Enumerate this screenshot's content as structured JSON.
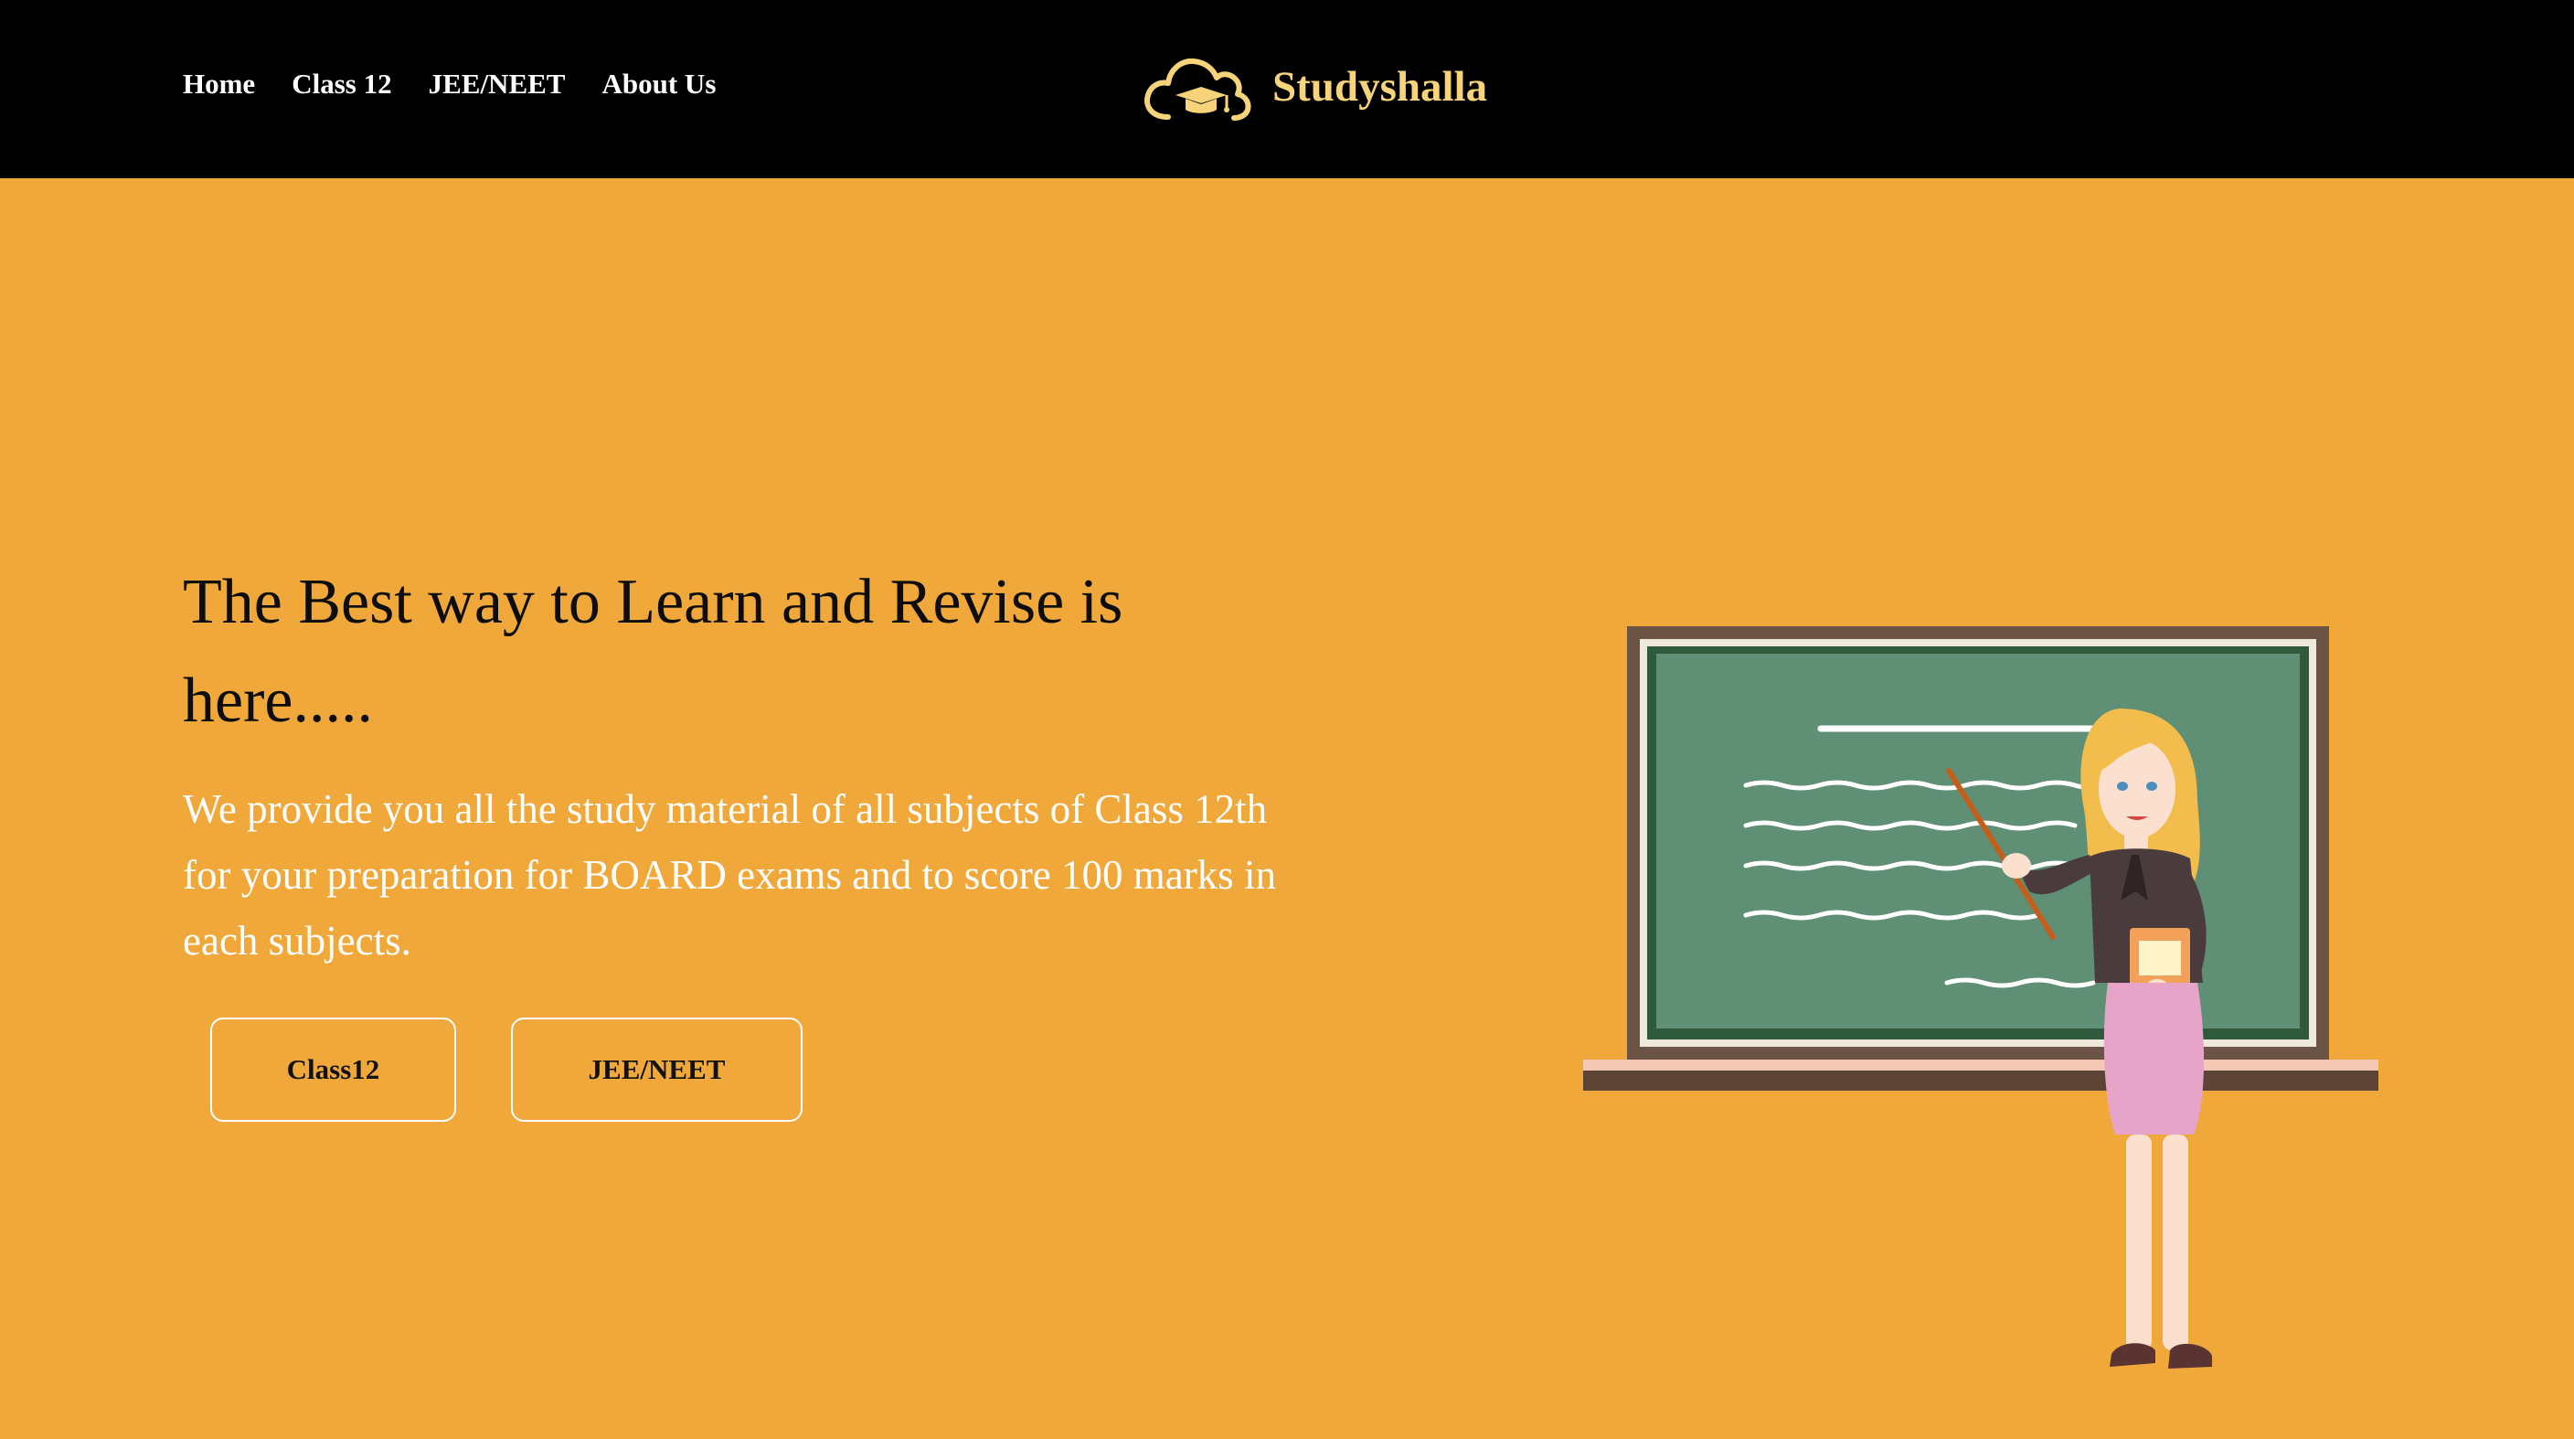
{
  "nav": {
    "links": [
      "Home",
      "Class 12",
      "JEE/NEET",
      "About Us"
    ],
    "brand_name": "Studyshalla",
    "brand_icon": "cloud-graduation-cap-icon"
  },
  "hero": {
    "title": "The Best way to Learn and Revise is here.....",
    "description": "We provide you all the study material of all subjects of Class 12th for your preparation for BOARD exams and to score 100 marks in each subjects.",
    "buttons": [
      "Class12",
      "JEE/NEET"
    ],
    "illustration": "teacher-at-chalkboard-illustration"
  },
  "colors": {
    "navbar_bg": "#000000",
    "hero_bg": "#f0a83a",
    "brand": "#f7d47a",
    "chalkboard": "#5f8f75",
    "board_frame": "#6b5446"
  }
}
